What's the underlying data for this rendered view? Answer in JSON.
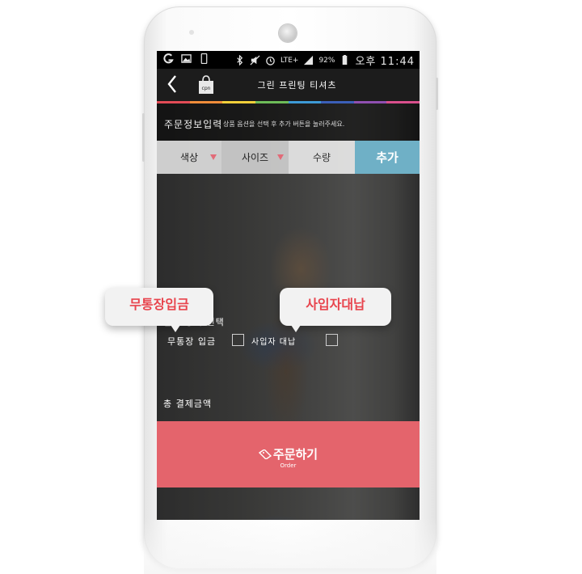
{
  "statusbar": {
    "battery": "92%",
    "network": "LTE+",
    "time": "오후 11:44"
  },
  "appbar": {
    "title": "그린 프린팅 티셔츠",
    "bag_label": "cpn"
  },
  "order_info": {
    "label": "주문정보입력",
    "hint": "상품 옵션을 선택 후 추가 버튼을 눌러주세요."
  },
  "options": {
    "color": "색상",
    "size": "사이즈",
    "quantity": "수량",
    "add": "추가"
  },
  "payment": {
    "title": "결제 방식 선택",
    "option1": "무통장 입금",
    "option2": "사입자 대납"
  },
  "total": {
    "label": "총 결제금액"
  },
  "order_button": {
    "label": "주문하기",
    "sub": "Order"
  },
  "callouts": {
    "bank_transfer": "무통장입금",
    "buyer_payment": "사입자대납"
  },
  "colors": {
    "accent_red": "#e4646c",
    "add_button": "#6fb0c6",
    "callout_text": "#e8444d"
  }
}
